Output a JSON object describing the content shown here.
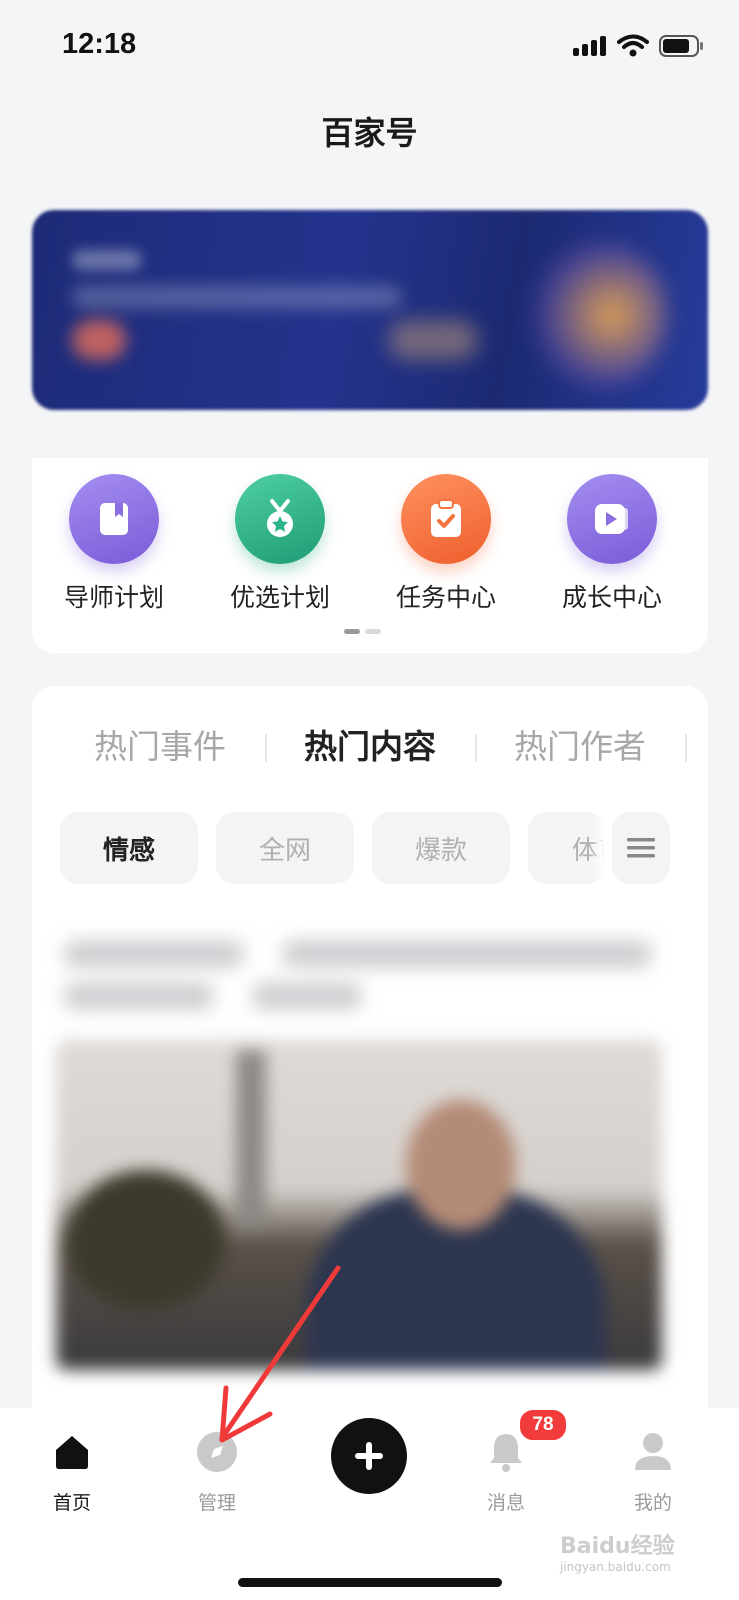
{
  "status": {
    "time": "12:18"
  },
  "header": {
    "title": "百家号"
  },
  "quick_entries": [
    {
      "label": "导师计划",
      "icon": "bookmark-book-icon",
      "color": "#8b6fe0"
    },
    {
      "label": "优选计划",
      "icon": "medal-icon",
      "color": "#2bb48a"
    },
    {
      "label": "任务中心",
      "icon": "clipboard-check-icon",
      "color": "#f5733f"
    },
    {
      "label": "成长中心",
      "icon": "video-play-icon",
      "color": "#8b6fe0"
    }
  ],
  "hot": {
    "tabs": [
      "热门事件",
      "热门内容",
      "热门作者"
    ],
    "active_tab": "热门内容",
    "chips": [
      "情感",
      "全网",
      "爆款",
      "体育"
    ],
    "active_chip": "情感"
  },
  "tabbar": {
    "items": [
      {
        "label": "首页",
        "icon": "home-icon"
      },
      {
        "label": "管理",
        "icon": "compass-icon"
      },
      {
        "label": "消息",
        "icon": "bell-icon"
      },
      {
        "label": "我的",
        "icon": "user-icon"
      }
    ],
    "badge": "78"
  },
  "watermark": {
    "brand": "Baidu经验",
    "url": "jingyan.baidu.com"
  },
  "colors": {
    "accent": "#1a1a1a",
    "badge": "#f23b3b",
    "annotation_arrow": "#f03a3a"
  }
}
